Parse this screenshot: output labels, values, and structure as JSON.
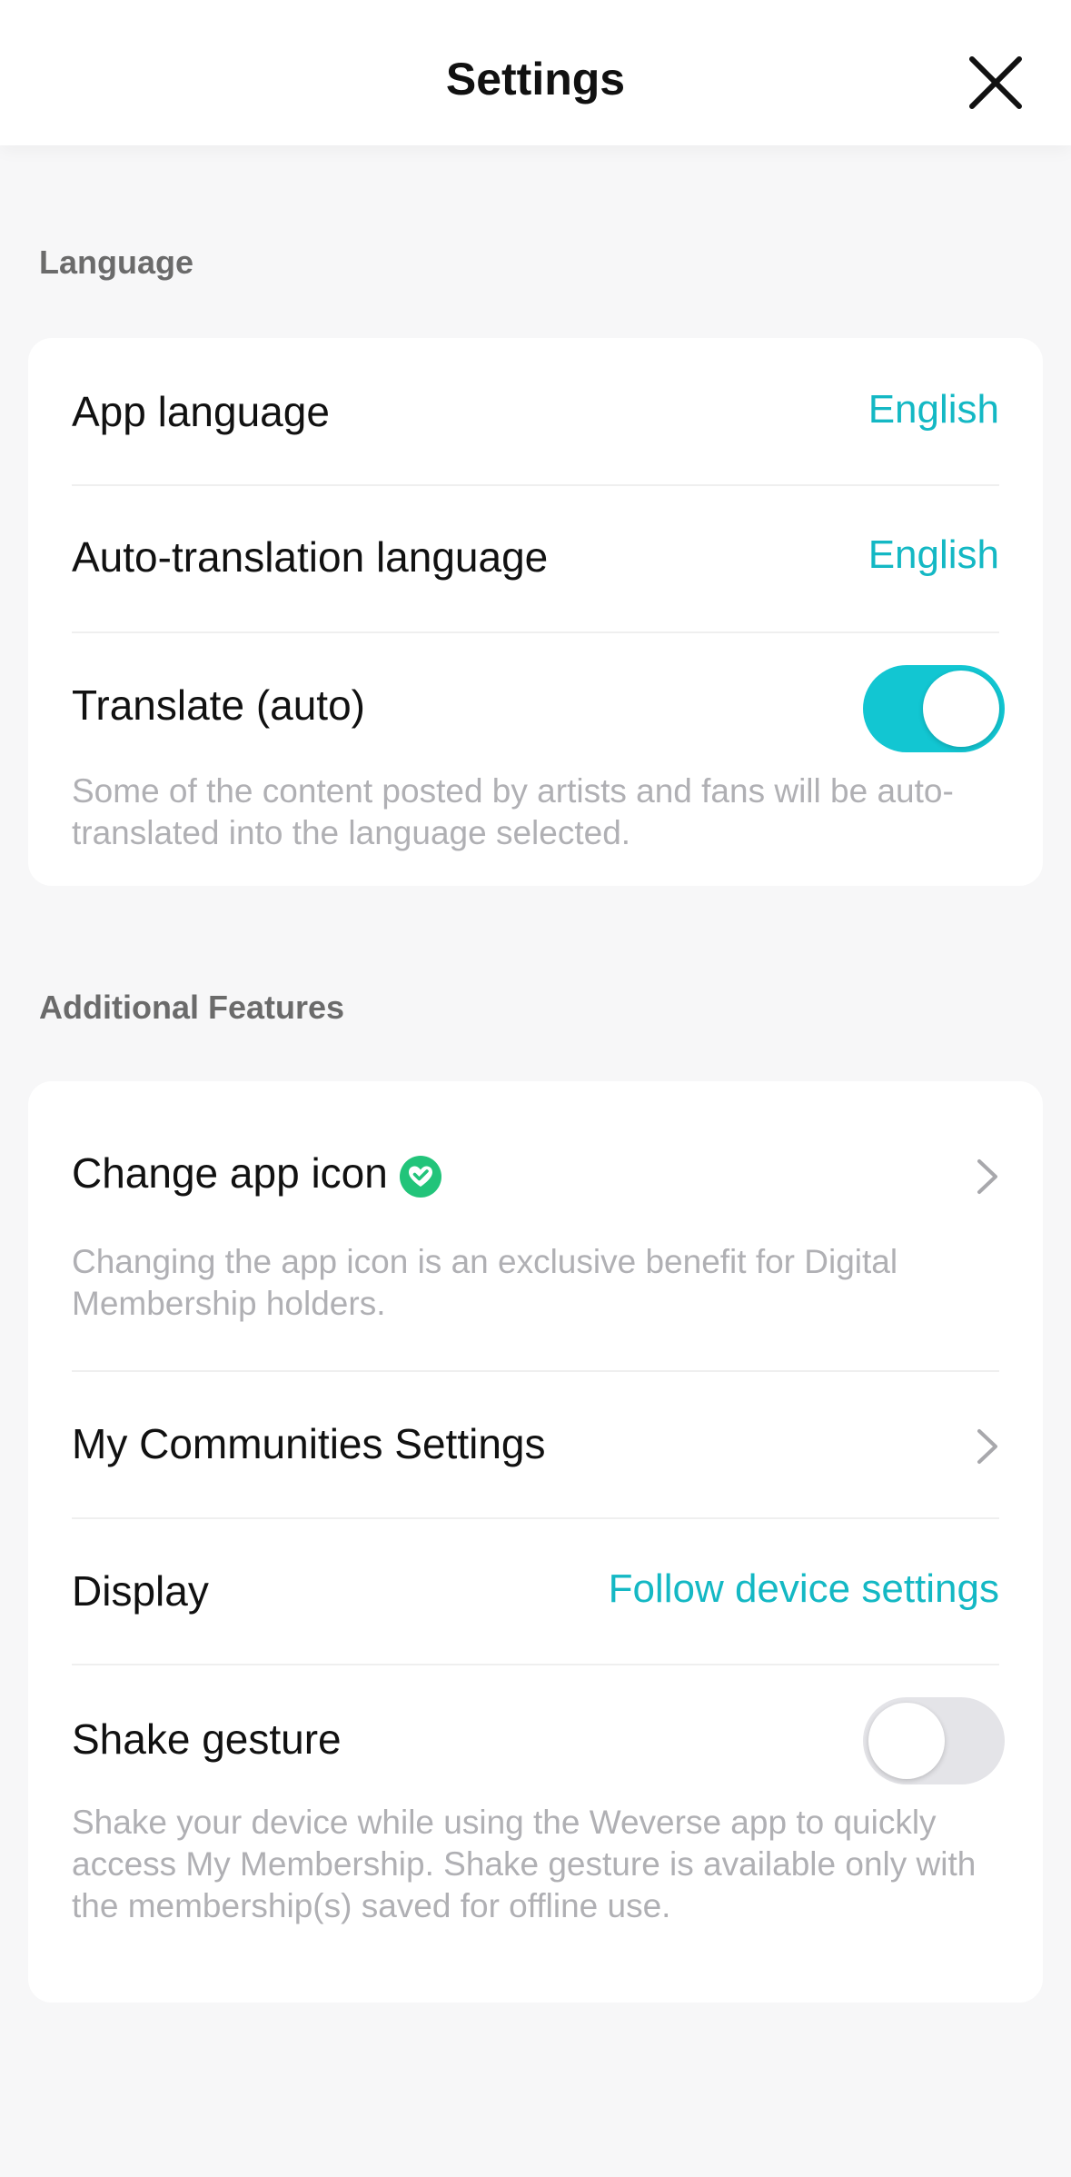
{
  "header": {
    "title": "Settings",
    "close_icon": "close-icon"
  },
  "language_section": {
    "label": "Language",
    "app_language": {
      "label": "App language",
      "value": "English"
    },
    "auto_translation_language": {
      "label": "Auto-translation language",
      "value": "English"
    },
    "translate_auto": {
      "label": "Translate (auto)",
      "enabled": true,
      "description": "Some of the content posted by artists and fans will be auto-translated into the language selected."
    }
  },
  "additional_section": {
    "label": "Additional Features",
    "change_app_icon": {
      "label": "Change app icon",
      "badge_icon": "membership-heart-badge-icon",
      "description": "Changing the app icon is an exclusive benefit for Digital Membership holders."
    },
    "my_communities": {
      "label": "My Communities Settings"
    },
    "display": {
      "label": "Display",
      "value": "Follow device settings"
    },
    "shake_gesture": {
      "label": "Shake gesture",
      "enabled": false,
      "description": "Shake your device while using the Weverse app to quickly access My Membership. Shake gesture is available only with the membership(s) saved for offline use."
    }
  },
  "colors": {
    "accent": "#12c6d2",
    "accent_text": "#14b8c4",
    "badge_green": "#22c47a",
    "muted_text": "#b0b0b4",
    "section_label": "#6b6b6b"
  }
}
